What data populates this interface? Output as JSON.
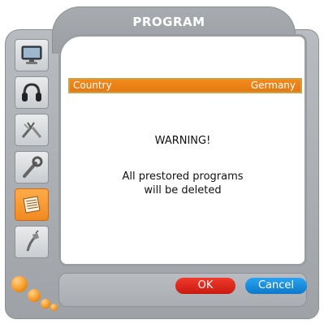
{
  "window": {
    "title": "PROGRAM"
  },
  "sidebar": {
    "items": [
      {
        "icon": "monitor-icon",
        "active": false
      },
      {
        "icon": "headphones-icon",
        "active": false
      },
      {
        "icon": "tools-icon",
        "active": false
      },
      {
        "icon": "wrench-icon",
        "active": false
      },
      {
        "icon": "document-list-icon",
        "active": true
      },
      {
        "icon": "plug-icon",
        "active": false
      }
    ]
  },
  "settings": {
    "country_label": "Country",
    "country_value": "Germany"
  },
  "dialog": {
    "warning_title": "WARNING!",
    "message_line1": "All prestored programs",
    "message_line2": "will be deleted"
  },
  "buttons": {
    "ok_label": "OK",
    "cancel_label": "Cancel"
  },
  "colors": {
    "accent_orange": "#f08a1f",
    "ok_red": "#d9241a",
    "cancel_blue": "#1a8fe0"
  }
}
